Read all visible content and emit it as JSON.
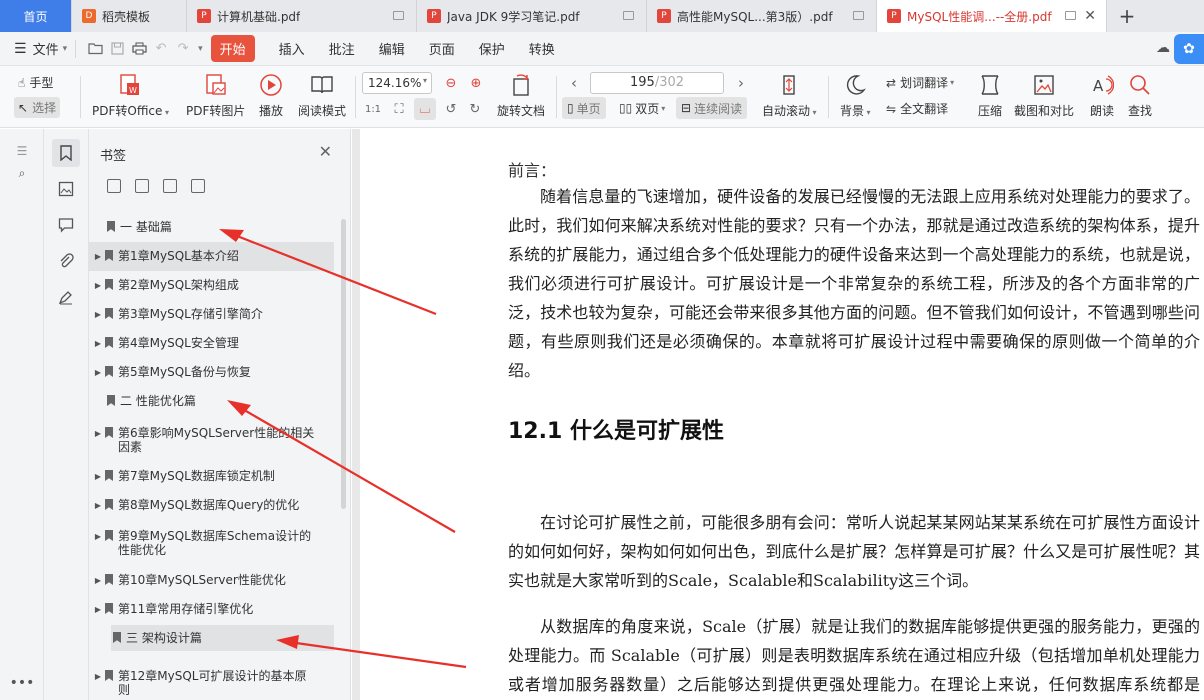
{
  "tabs": [
    {
      "label": "首页"
    },
    {
      "label": "稻壳模板"
    },
    {
      "label": "计算机基础.pdf"
    },
    {
      "label": "Java JDK 9学习笔记.pdf"
    },
    {
      "label": "高性能MySQL...第3版）.pdf"
    },
    {
      "label": "MySQL性能调...--全册.pdf"
    }
  ],
  "menubar": {
    "file": "文件",
    "start": "开始",
    "items": [
      "插入",
      "批注",
      "编辑",
      "页面",
      "保护",
      "转换"
    ]
  },
  "toolbar": {
    "hand": "手型",
    "select": "选择",
    "pdf_to_office": "PDF转Office",
    "pdf_to_image": "PDF转图片",
    "play": "播放",
    "read_mode": "阅读模式",
    "zoom": "124.16%",
    "rotate": "旋转文档",
    "page_current": "195",
    "page_total": "/302",
    "single": "单页",
    "double": "双页",
    "continuous": "连续阅读",
    "auto_scroll": "自动滚动",
    "background": "背景",
    "word_translate": "划词翻译",
    "full_translate": "全文翻译",
    "compress": "压缩",
    "screenshot_compare": "截图和对比",
    "read_aloud": "朗读",
    "find": "查找"
  },
  "bookmarks": {
    "title": "书签",
    "items": [
      {
        "label": "一  基础篇",
        "expandable": false
      },
      {
        "label": "第1章MySQL基本介绍",
        "expandable": true
      },
      {
        "label": "第2章MySQL架构组成",
        "expandable": true
      },
      {
        "label": "第3章MySQL存储引擎简介",
        "expandable": true
      },
      {
        "label": "第4章MySQL安全管理",
        "expandable": true
      },
      {
        "label": "第5章MySQL备份与恢复",
        "expandable": true
      },
      {
        "label": "二  性能优化篇",
        "expandable": false
      },
      {
        "label": "第6章影响MySQLServer性能的相关因素",
        "expandable": true
      },
      {
        "label": "第7章MySQL数据库锁定机制",
        "expandable": true
      },
      {
        "label": "第8章MySQL数据库Query的优化",
        "expandable": true
      },
      {
        "label": "第9章MySQL数据库Schema设计的性能优化",
        "expandable": true
      },
      {
        "label": "第10章MySQLServer性能优化",
        "expandable": true
      },
      {
        "label": "第11章常用存储引擎优化",
        "expandable": true
      },
      {
        "label": "三  架构设计篇",
        "expandable": false
      },
      {
        "label": "第12章MySQL可扩展设计的基本原则",
        "expandable": true
      }
    ]
  },
  "document": {
    "preface_heading": "前言：",
    "para1": "随着信息量的飞速增加，硬件设备的发展已经慢慢的无法跟上应用系统对处理能力的要求了。此时，我们如何来解决系统对性能的要求？只有一个办法，那就是通过改造系统的架构体系，提升系统的扩展能力，通过组合多个低处理能力的硬件设备来达到一个高处理能力的系统，也就是说，我们必须进行可扩展设计。可扩展设计是一个非常复杂的系统工程，所涉及的各个方面非常的广泛，技术也较为复杂，可能还会带来很多其他方面的问题。但不管我们如何设计，不管遇到哪些问题，有些原则我们还是必须确保的。本章就将可扩展设计过程中需要确保的原则做一个简单的介绍。",
    "section_heading": "12.1 什么是可扩展性",
    "para2": "在讨论可扩展性之前，可能很多朋有会问：常听人说起某某网站某某系统在可扩展性方面设计的如何如何好，架构如何如何出色，到底什么是扩展？怎样算是可扩展？什么又是可扩展性呢？其实也就是大家常听到的Scale，Scalable和Scalability这三个词。",
    "para3": "从数据库的角度来说，Scale（扩展）就是让我们的数据库能够提供更强的服务能力，更强的处理能力。而 Scalable（可扩展）则是表明数据库系统在通过相应升级（包括增加单机处理能力或者增加服务器数量）之后能够达到提供更强处理能力。在理论上来说，任何数据库系统都是 Scalable 的，只不过是所需要的实现方式不一样而已。最后，"
  },
  "colors": {
    "accent": "#3f7ee8",
    "start_button": "#e8533e",
    "annotation_arrow": "#e8302a"
  }
}
